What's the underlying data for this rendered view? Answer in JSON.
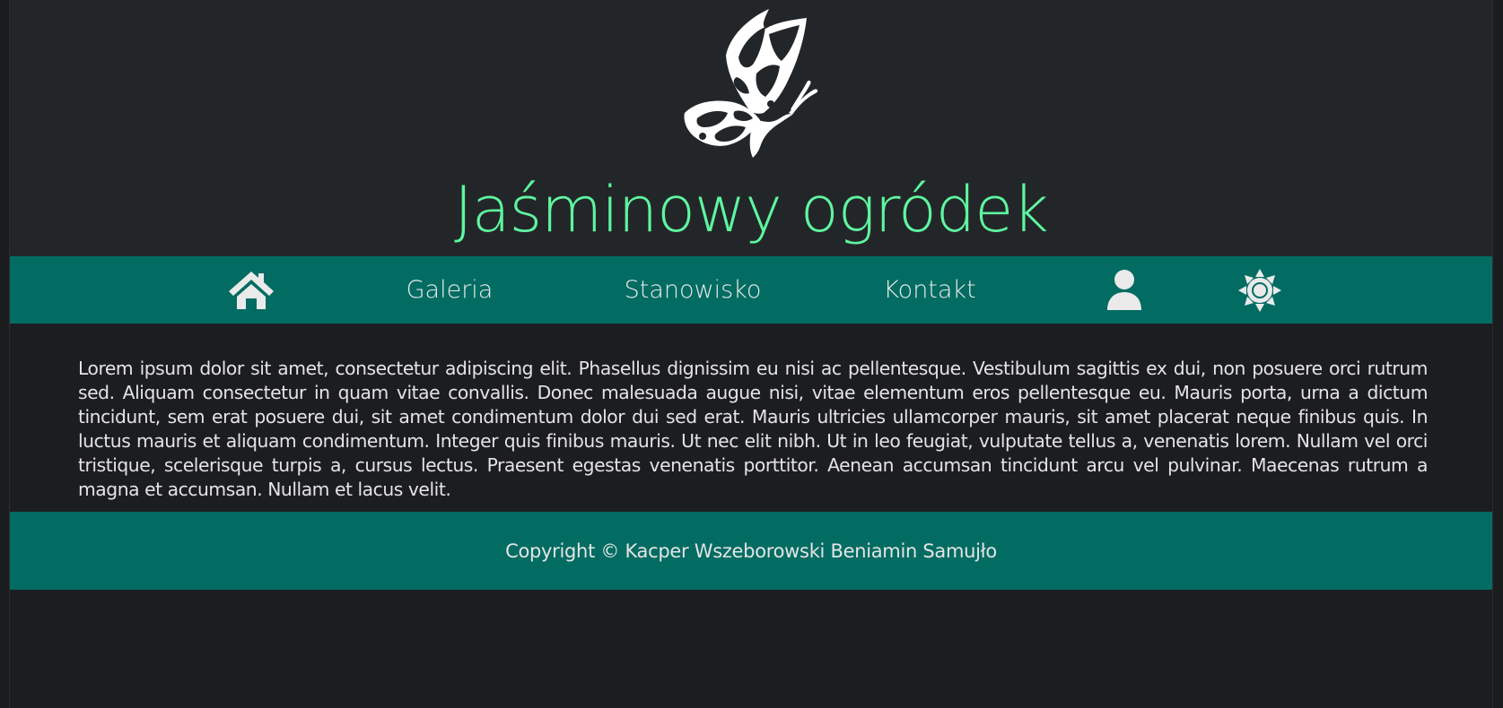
{
  "colors": {
    "page_bg": "#1c1d20",
    "header_bg": "#232628",
    "title": "#5ef5a0",
    "nav_bg": "#026c62",
    "footer_bg": "#026c62",
    "text": "#e4e4e4"
  },
  "header": {
    "logo_icon": "butterfly-icon",
    "title": "Jaśminowy ogródek"
  },
  "nav": {
    "home_icon": "home-icon",
    "items": [
      {
        "label": "Galeria"
      },
      {
        "label": "Stanowisko"
      },
      {
        "label": "Kontakt"
      }
    ],
    "user_icon": "user-icon",
    "theme_icon": "sun-icon"
  },
  "main": {
    "paragraph": "Lorem ipsum dolor sit amet, consectetur adipiscing elit. Phasellus dignissim eu nisi ac pellentesque. Vestibulum sagittis ex dui, non posuere orci rutrum sed. Aliquam consectetur in quam vitae convallis. Donec malesuada augue nisi, vitae elementum eros pellentesque eu. Mauris porta, urna a dictum tincidunt, sem erat posuere dui, sit amet condimentum dolor dui sed erat. Mauris ultricies ullamcorper mauris, sit amet placerat neque finibus quis. In luctus mauris et aliquam condimentum. Integer quis finibus mauris. Ut nec elit nibh. Ut in leo feugiat, vulputate tellus a, venenatis lorem. Nullam vel orci tristique, scelerisque turpis a, cursus lectus. Praesent egestas venenatis porttitor. Aenean accumsan tincidunt arcu vel pulvinar. Maecenas rutrum a magna et accumsan. Nullam et lacus velit."
  },
  "footer": {
    "text": "Copyright © Kacper Wszeborowski Beniamin Samujło"
  }
}
